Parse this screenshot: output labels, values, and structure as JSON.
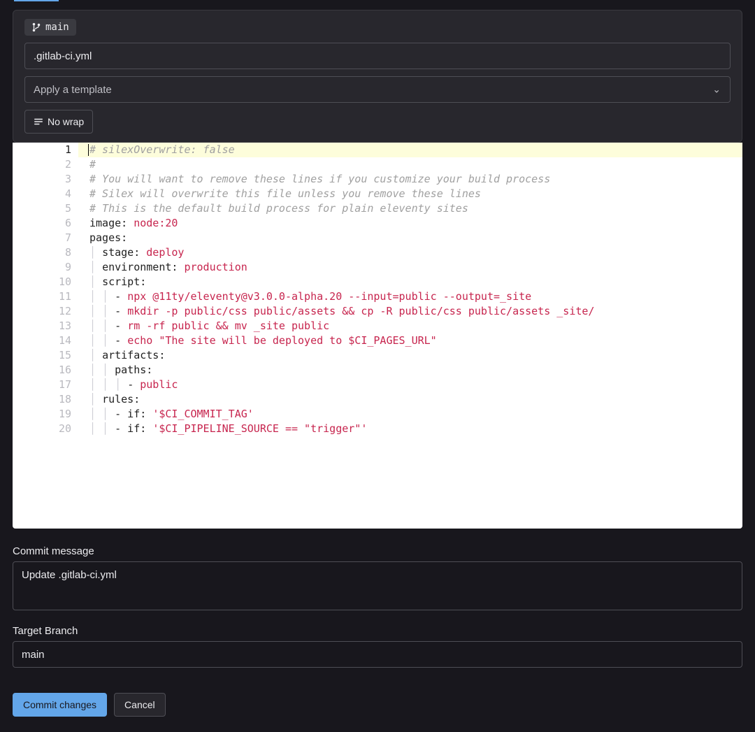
{
  "branch": "main",
  "filename": ".gitlab-ci.yml",
  "template_placeholder": "Apply a template",
  "wrap_button": "No wrap",
  "code_lines": [
    {
      "n": 1,
      "segs": [
        {
          "c": "tok-comment",
          "t": "# silexOverwrite: false"
        }
      ],
      "current": true
    },
    {
      "n": 2,
      "segs": [
        {
          "c": "tok-comment",
          "t": "#"
        }
      ]
    },
    {
      "n": 3,
      "segs": [
        {
          "c": "tok-comment",
          "t": "# You will want to remove these lines if you customize your build process"
        }
      ]
    },
    {
      "n": 4,
      "segs": [
        {
          "c": "tok-comment",
          "t": "# Silex will overwrite this file unless you remove these lines"
        }
      ]
    },
    {
      "n": 5,
      "segs": [
        {
          "c": "tok-comment",
          "t": "# This is the default build process for plain eleventy sites"
        }
      ]
    },
    {
      "n": 6,
      "segs": [
        {
          "c": "tok-key",
          "t": "image: "
        },
        {
          "c": "tok-val",
          "t": "node:20"
        }
      ]
    },
    {
      "n": 7,
      "segs": [
        {
          "c": "tok-key",
          "t": "pages:"
        }
      ]
    },
    {
      "n": 8,
      "segs": [
        {
          "c": "indent-guide",
          "t": "│ "
        },
        {
          "c": "tok-key",
          "t": "stage: "
        },
        {
          "c": "tok-val",
          "t": "deploy"
        }
      ]
    },
    {
      "n": 9,
      "segs": [
        {
          "c": "indent-guide",
          "t": "│ "
        },
        {
          "c": "tok-key",
          "t": "environment: "
        },
        {
          "c": "tok-val",
          "t": "production"
        }
      ]
    },
    {
      "n": 10,
      "segs": [
        {
          "c": "indent-guide",
          "t": "│ "
        },
        {
          "c": "tok-key",
          "t": "script:"
        }
      ]
    },
    {
      "n": 11,
      "segs": [
        {
          "c": "indent-guide",
          "t": "│ │ "
        },
        {
          "c": "tok-key",
          "t": "- "
        },
        {
          "c": "tok-val",
          "t": "npx @11ty/eleventy@v3.0.0-alpha.20 --input=public --output=_site"
        }
      ]
    },
    {
      "n": 12,
      "segs": [
        {
          "c": "indent-guide",
          "t": "│ │ "
        },
        {
          "c": "tok-key",
          "t": "- "
        },
        {
          "c": "tok-val",
          "t": "mkdir -p public/css public/assets && cp -R public/css public/assets _site/"
        }
      ]
    },
    {
      "n": 13,
      "segs": [
        {
          "c": "indent-guide",
          "t": "│ │ "
        },
        {
          "c": "tok-key",
          "t": "- "
        },
        {
          "c": "tok-val",
          "t": "rm -rf public && mv _site public"
        }
      ]
    },
    {
      "n": 14,
      "segs": [
        {
          "c": "indent-guide",
          "t": "│ │ "
        },
        {
          "c": "tok-key",
          "t": "- "
        },
        {
          "c": "tok-val",
          "t": "echo \"The site will be deployed to $CI_PAGES_URL\""
        }
      ]
    },
    {
      "n": 15,
      "segs": [
        {
          "c": "indent-guide",
          "t": "│ "
        },
        {
          "c": "tok-key",
          "t": "artifacts:"
        }
      ]
    },
    {
      "n": 16,
      "segs": [
        {
          "c": "indent-guide",
          "t": "│ │ "
        },
        {
          "c": "tok-key",
          "t": "paths:"
        }
      ]
    },
    {
      "n": 17,
      "segs": [
        {
          "c": "indent-guide",
          "t": "│ │ │ "
        },
        {
          "c": "tok-key",
          "t": "- "
        },
        {
          "c": "tok-val",
          "t": "public"
        }
      ]
    },
    {
      "n": 18,
      "segs": [
        {
          "c": "indent-guide",
          "t": "│ "
        },
        {
          "c": "tok-key",
          "t": "rules:"
        }
      ]
    },
    {
      "n": 19,
      "segs": [
        {
          "c": "indent-guide",
          "t": "│ │ "
        },
        {
          "c": "tok-key",
          "t": "- if: "
        },
        {
          "c": "tok-str",
          "t": "'$CI_COMMIT_TAG'"
        }
      ]
    },
    {
      "n": 20,
      "segs": [
        {
          "c": "indent-guide",
          "t": "│ │ "
        },
        {
          "c": "tok-key",
          "t": "- if: "
        },
        {
          "c": "tok-str",
          "t": "'$CI_PIPELINE_SOURCE == \"trigger\"'"
        }
      ]
    }
  ],
  "commit": {
    "message_label": "Commit message",
    "message_value": "Update .gitlab-ci.yml",
    "branch_label": "Target Branch",
    "branch_value": "main",
    "submit_label": "Commit changes",
    "cancel_label": "Cancel"
  }
}
